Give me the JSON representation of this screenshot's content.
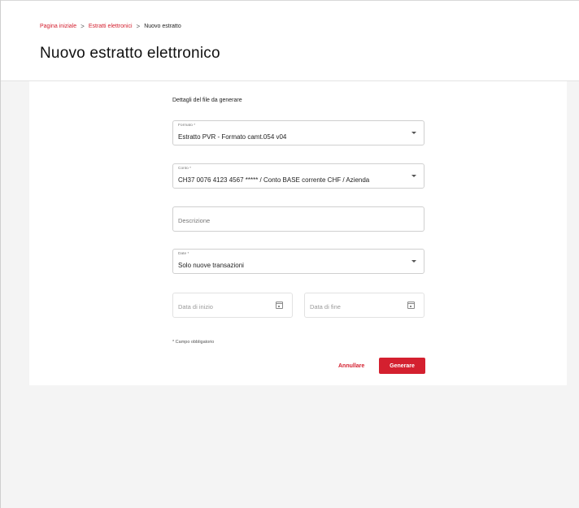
{
  "breadcrumb": {
    "home": "Pagina iniziale",
    "statements": "Estratti elettronici",
    "current": "Nuovo estratto",
    "separator": ">"
  },
  "page": {
    "title": "Nuovo estratto elettronico"
  },
  "form": {
    "section_title": "Dettagli del file da generare",
    "format": {
      "label": "Formato *",
      "value": "Estratto PVR - Formato camt.054 v04"
    },
    "account": {
      "label": "Conto *",
      "value": "CH37 0076 4123 4567 ***** / Conto BASE corrente CHF / Azienda"
    },
    "description": {
      "placeholder": "Descrizione"
    },
    "date": {
      "label": "Date *",
      "value": "Solo nuove transazioni"
    },
    "start_date": {
      "placeholder": "Data di inizio"
    },
    "end_date": {
      "placeholder": "Data di fine"
    },
    "required_note": "* Campo obbligatorio"
  },
  "actions": {
    "cancel_label": "Annullare",
    "generate_label": "Generare"
  },
  "colors": {
    "accent": "#d4202f",
    "page_background": "#f4f4f4",
    "card_background": "#ffffff"
  },
  "icons": {
    "select_caret": "chevron-down-icon",
    "date_picker": "calendar-icon"
  }
}
